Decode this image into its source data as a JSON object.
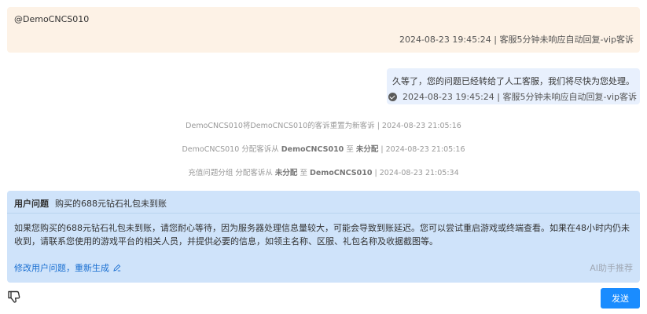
{
  "messages": {
    "customer": {
      "sender": "@DemoCNCS010",
      "meta": "2024-08-23 19:45:24 | 客服5分钟未响应自动回复-vip客诉"
    },
    "agent": {
      "text": "久等了，您的问题已经转给了人工客服，我们将尽快为您处理。",
      "meta": "2024-08-23 19:45:24 | 客服5分钟未响应自动回复-vip客诉"
    }
  },
  "system_notes": [
    {
      "text": "DemoCNCS010将DemoCNCS010的客诉重置为新客诉 | 2024-08-23 21:05:16"
    },
    {
      "pre": "DemoCNCS010 分配客诉从 ",
      "bold1": "DemoCNCS010",
      "mid": " 至 ",
      "bold2": "未分配",
      "post": " | 2024-08-23 21:05:16"
    },
    {
      "pre": "充值问题分组 分配客诉从 ",
      "bold1": "未分配",
      "mid": " 至 ",
      "bold2": "DemoCNCS010",
      "post": " | 2024-08-23 21:05:34"
    }
  ],
  "ai_assistant": {
    "question_label": "用户问题",
    "question": "购买的688元钻石礼包未到账",
    "answer": "如果您购买的688元钻石礼包未到账，请您耐心等待，因为服务器处理信息量较大，可能会导致到账延迟。您可以尝试重启游戏或终端查看。如果在48小时内仍未收到，请联系您使用的游戏平台的相关人员，并提供必要的信息，如领主名称、区服、礼包名称及收据截图等。",
    "edit_link": "修改用户问题，重新生成",
    "tag": "AI助手推荐"
  },
  "footer": {
    "send_label": "发送",
    "dislike_icon": "thumbs-down-icon"
  },
  "colors": {
    "customer_bg": "#fdf2e6",
    "agent_bg": "#e8f0fd",
    "ai_bg": "#cfe3fa",
    "accent": "#1a8cff",
    "link": "#1a6fd1"
  }
}
